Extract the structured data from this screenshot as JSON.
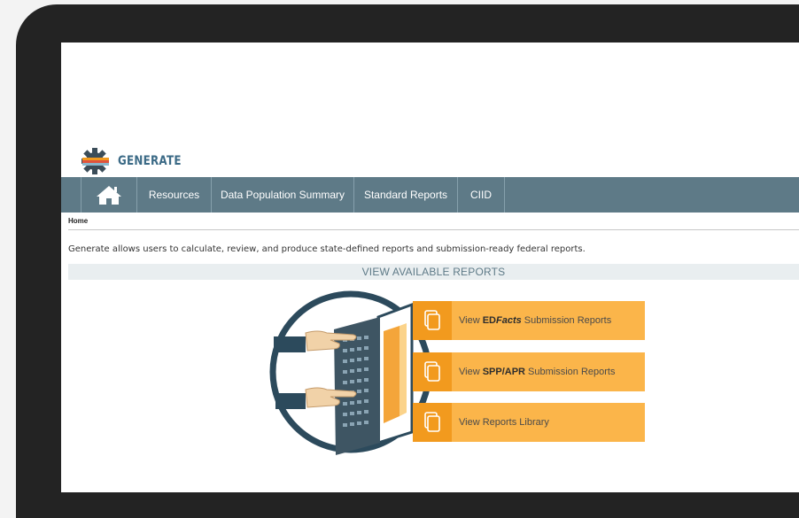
{
  "app": {
    "logo_text": "GENERATE"
  },
  "nav": {
    "items": [
      {
        "label": "Resources"
      },
      {
        "label": "Data Population Summary"
      },
      {
        "label": "Standard Reports"
      },
      {
        "label": "CIID"
      }
    ]
  },
  "breadcrumb": "Home",
  "intro_text": "Generate allows users to calculate, review, and produce state-defined reports and submission-ready federal reports.",
  "section_title": "VIEW AVAILABLE REPORTS",
  "reports": [
    {
      "prefix": "View ",
      "bold": "ED",
      "bold_italic": "Facts",
      "suffix": " Submission Reports"
    },
    {
      "prefix": "View ",
      "bold": "SPP/APR",
      "bold_italic": "",
      "suffix": " Submission Reports"
    },
    {
      "prefix": "View Reports Library",
      "bold": "",
      "bold_italic": "",
      "suffix": ""
    }
  ],
  "colors": {
    "nav_bg": "#5e7a87",
    "button_bg": "#fbb54a",
    "button_icon_bg": "#f29a1e",
    "brand": "#3b6a86"
  }
}
